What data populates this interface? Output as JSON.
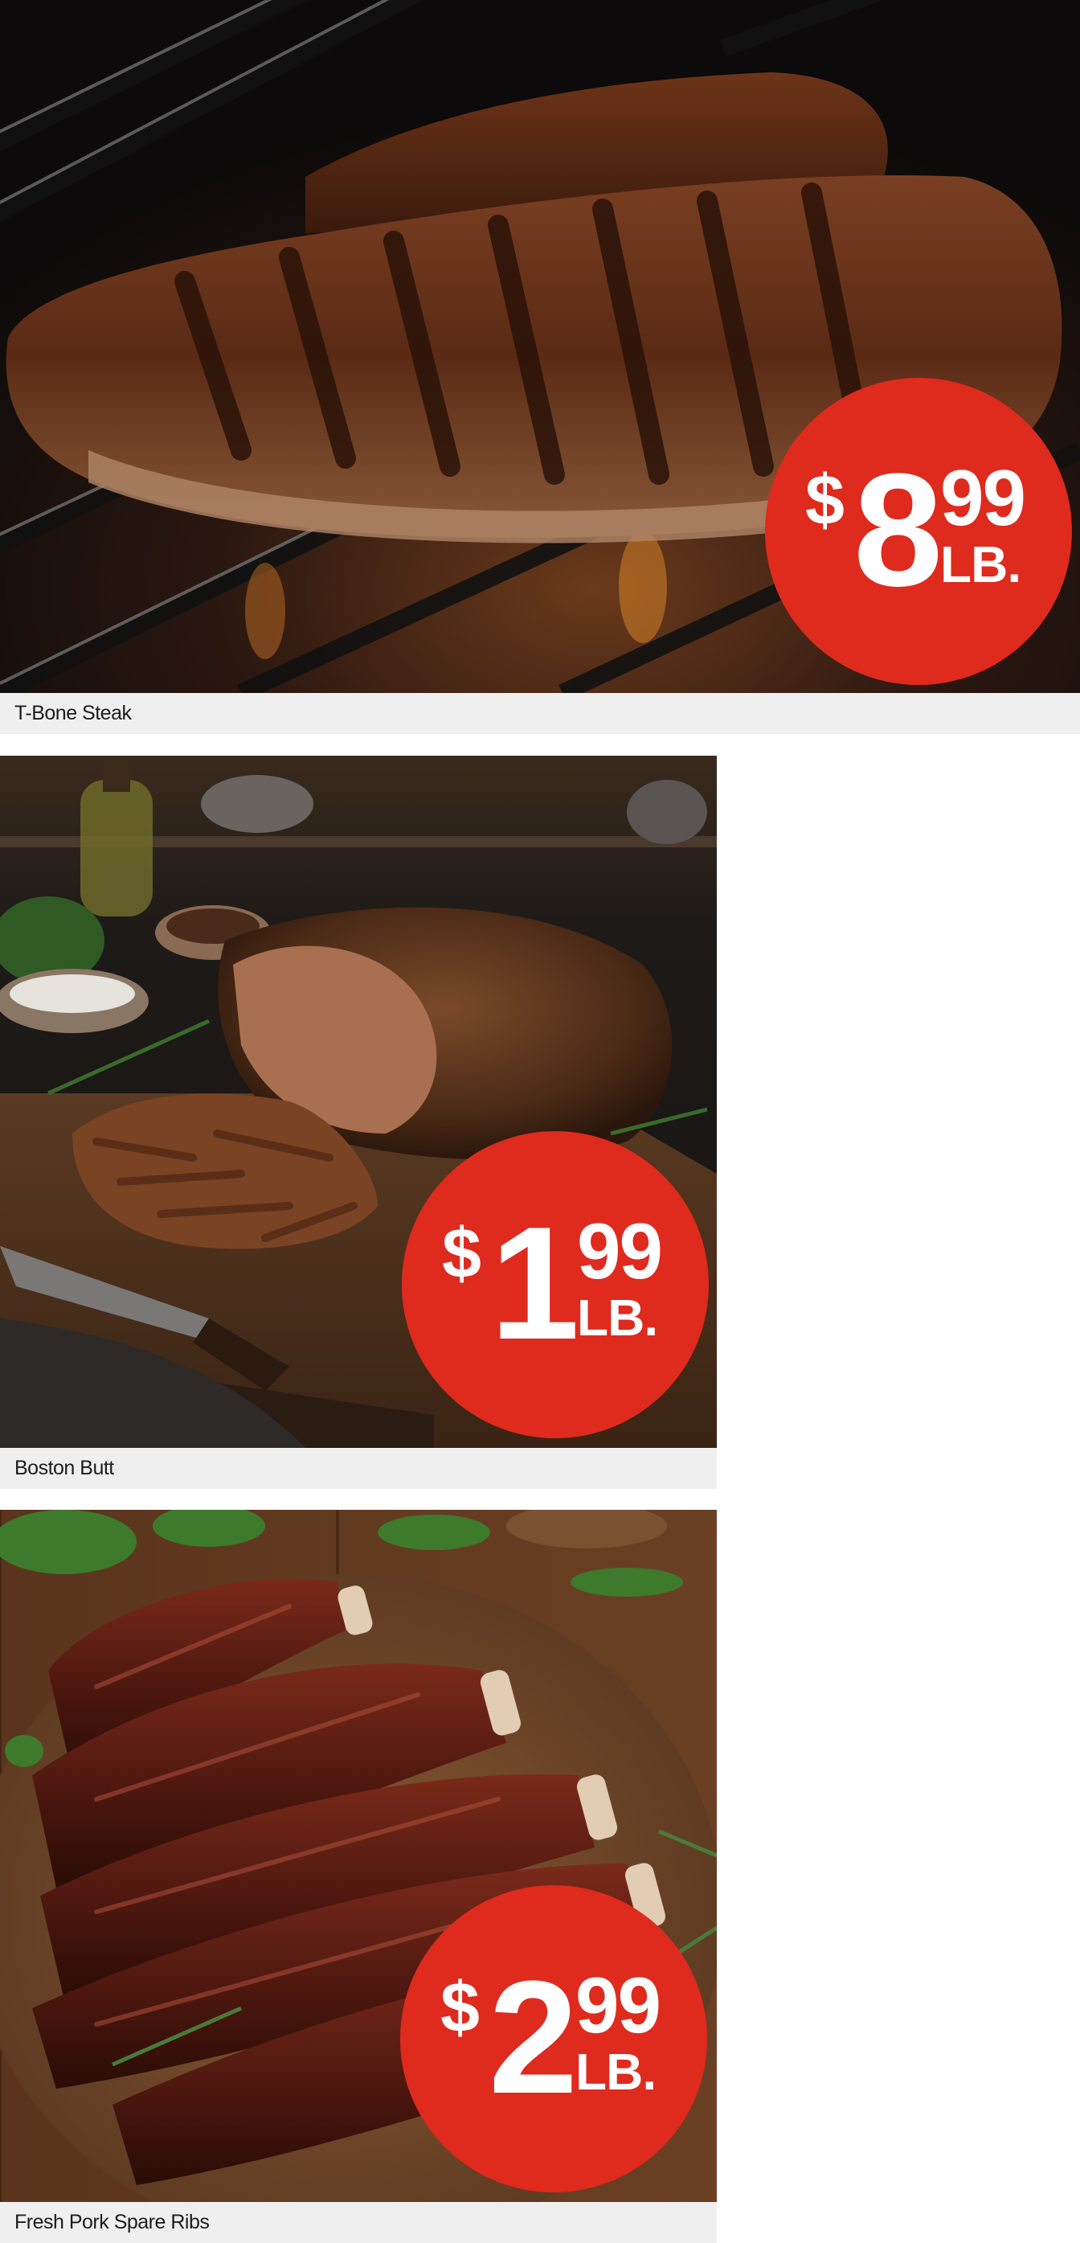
{
  "products": [
    {
      "name": "T-Bone Steak",
      "image_subject": "grilled-steak",
      "price": {
        "currency": "$",
        "whole": "8",
        "cents": "99",
        "unit": "LB."
      }
    },
    {
      "name": "Boston Butt",
      "image_subject": "pulled-pork",
      "price": {
        "currency": "$",
        "whole": "1",
        "cents": "99",
        "unit": "LB."
      }
    },
    {
      "name": "Fresh Pork Spare Ribs",
      "image_subject": "spare-ribs",
      "price": {
        "currency": "$",
        "whole": "2",
        "cents": "99",
        "unit": "LB."
      }
    }
  ],
  "colors": {
    "badge": "#df2a1e",
    "caption_bg": "#efefef",
    "caption_text": "#1c1c1c"
  }
}
